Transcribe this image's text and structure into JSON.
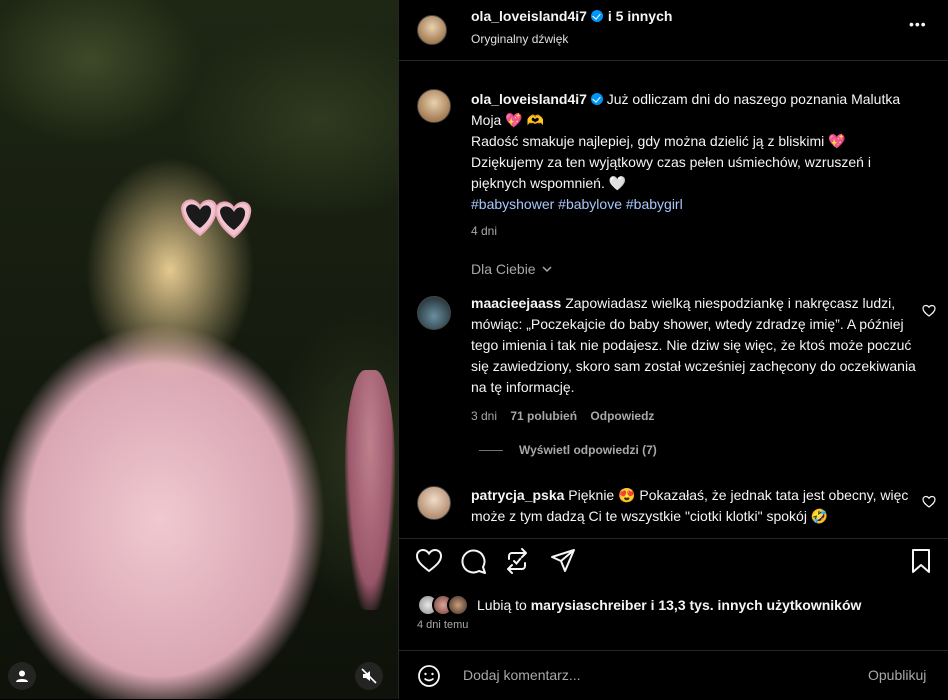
{
  "header": {
    "username": "ola_loveisland4i7",
    "others": "i 5 innych",
    "audio": "Oryginalny dźwięk",
    "more": "•••"
  },
  "caption": {
    "username": "ola_loveisland4i7",
    "line1": "Już odliczam dni do naszego poznania Malutka Moja 💖 🫶",
    "line2": "Radość smakuje najlepiej, gdy można dzielić ją z bliskimi 💖",
    "line3": "Dziękujemy za ten wyjątkowy czas pełen uśmiechów, wzruszeń i pięknych wspomnień. 🤍",
    "hashtags": "#babyshower #babylove #babygirl",
    "time": "4 dni"
  },
  "filter": {
    "label": "Dla Ciebie"
  },
  "comments": [
    {
      "username": "maacieejaass",
      "text": "Zapowiadasz wielką niespodziankę i nakręcasz ludzi, mówiąc: „Poczekajcie do baby shower, wtedy zdradzę imię”. A później tego imienia i tak nie podajesz. Nie dziw się więc, że ktoś może poczuć się zawiedziony, skoro sam został wcześniej zachęcony do oczekiwania na tę informację.",
      "time": "3 dni",
      "likes": "71 polubień",
      "reply": "Odpowiedz",
      "view_replies": "Wyświetl odpowiedzi (7)"
    },
    {
      "username": "patrycja_pska",
      "text": "Pięknie 😍 Pokazałaś, że jednak tata jest obecny, więc może z tym dadzą Ci te wszystkie \"ciotki klotki\" spokój 🤣"
    }
  ],
  "likes": {
    "prefix": "Lubią to",
    "user": "marysiaschreiber",
    "suffix": "i 13,3 tys. innych użytkowników"
  },
  "post_date": "4 dni temu",
  "add_comment": {
    "placeholder": "Dodaj komentarz...",
    "publish": "Opublikuj"
  },
  "colors": {
    "accent": "#0095f6",
    "hashtag": "#a8c7fa",
    "muted": "#a8a8a8"
  }
}
